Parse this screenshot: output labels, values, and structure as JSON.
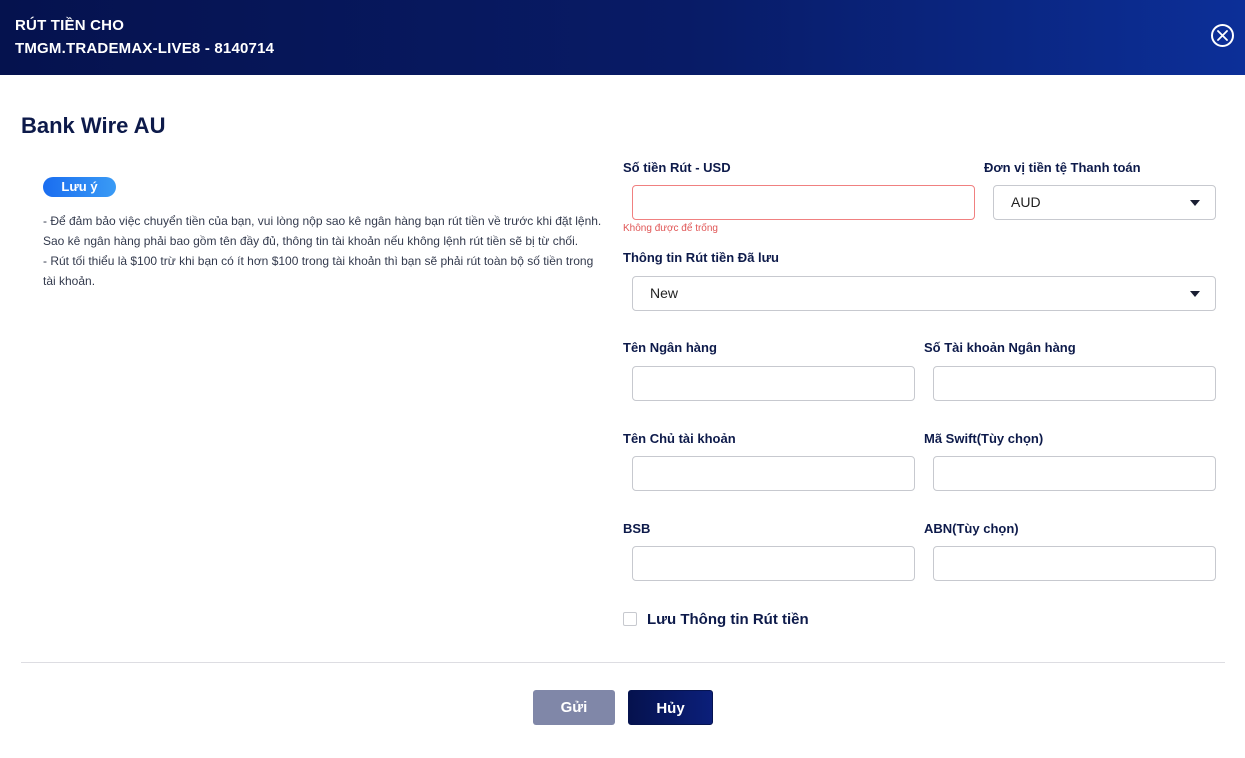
{
  "header": {
    "title_line1": "RÚT TIỀN CHO",
    "title_line2": "TMGM.TRADEMAX-LIVE8 - 8140714",
    "close_icon": "close-circle-icon"
  },
  "method_title": "Bank Wire AU",
  "note": {
    "badge": "Lưu ý",
    "line1": "- Để đảm bảo việc chuyển tiền của bạn, vui lòng nộp sao kê ngân hàng bạn rút tiền về trước khi đặt lệnh. Sao kê ngân hàng phải bao gồm tên đầy đủ, thông tin tài khoản nếu không lệnh rút tiền sẽ bị từ chối.",
    "line2": "- Rút tối thiểu là $100 trừ khi bạn có ít hơn $100 trong tài khoản thì bạn sẽ phải rút toàn bộ số tiền trong tài khoản."
  },
  "form": {
    "amount_label": "Số tiền Rút - USD",
    "amount_value": "",
    "amount_error": "Không được để trống",
    "currency_label": "Đơn vị tiền tệ Thanh toán",
    "currency_value": "AUD",
    "saved_info_label": "Thông tin Rút tiền Đã lưu",
    "saved_info_value": "New",
    "bank_name_label": "Tên Ngân hàng",
    "bank_account_label": "Số Tài khoản Ngân hàng",
    "holder_name_label": "Tên Chủ tài khoản",
    "swift_label": "Mã Swift(Tùy chọn)",
    "bsb_label": "BSB",
    "abn_label": "ABN(Tùy chọn)",
    "save_info_label": "Lưu Thông tin Rút tiền"
  },
  "actions": {
    "send": "Gửi",
    "cancel": "Hủy"
  },
  "colors": {
    "header_start": "#05124e",
    "header_end": "#0c2f98",
    "badge": "#1a6df0",
    "error": "#e05555",
    "send_button": "#8087a8",
    "cancel_button": "#05124e"
  }
}
